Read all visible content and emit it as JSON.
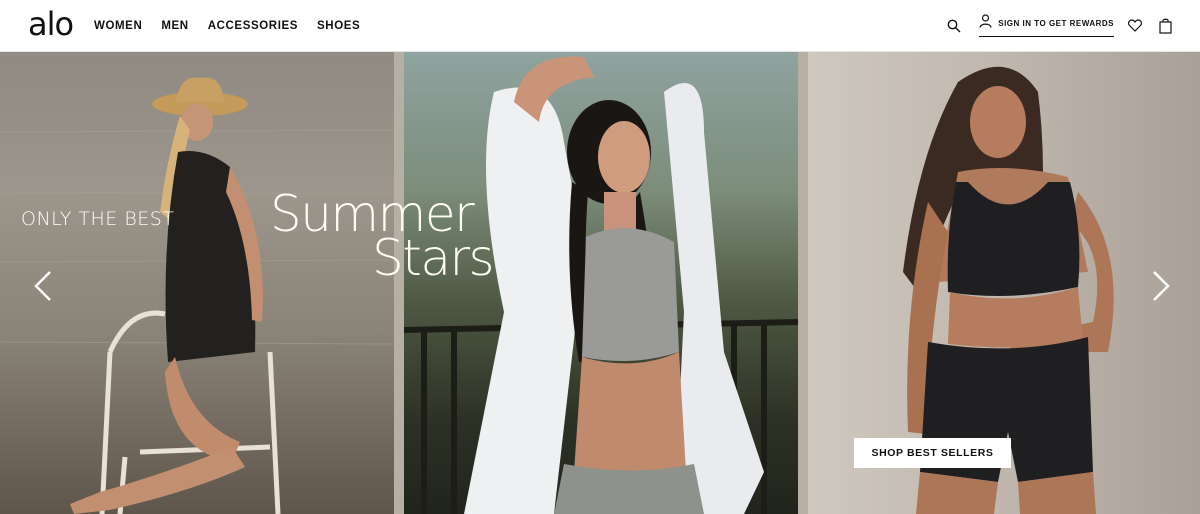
{
  "header": {
    "logo": "alo",
    "nav": [
      "WOMEN",
      "MEN",
      "ACCESSORIES",
      "SHOES"
    ],
    "signin_label": "SIGN IN TO GET REWARDS",
    "icons": [
      "search-icon",
      "user-icon",
      "heart-icon",
      "bag-icon"
    ]
  },
  "hero": {
    "eyebrow": "ONLY THE BEST",
    "title_line1": "Summer",
    "title_line2": "Stars",
    "cta": "SHOP BEST SELLERS",
    "prev_icon": "chevron-left-icon",
    "next_icon": "chevron-right-icon"
  }
}
